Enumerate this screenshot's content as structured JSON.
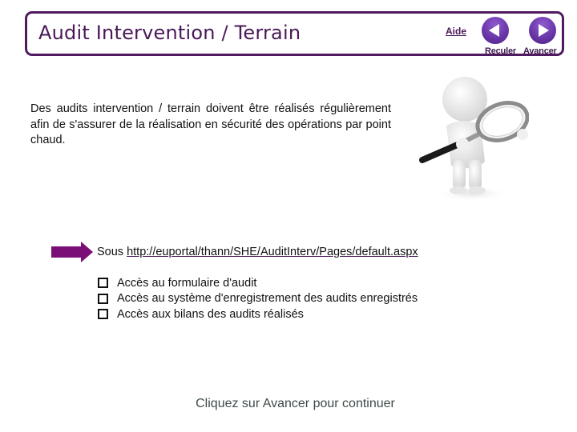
{
  "header": {
    "title": "Audit Intervention / Terrain",
    "help_link": "Aide",
    "nav": {
      "back_label": "Reculer",
      "forward_label": "Avancer"
    }
  },
  "intro": {
    "text": "Des audits intervention / terrain doivent être réalisés régulièrement afin de s'assurer de la réalisation en sécurité des opérations par point chaud."
  },
  "location": {
    "prefix": "Sous",
    "url": "http://euportal/thann/SHE/AuditInterv/Pages/default.aspx"
  },
  "bullets": [
    {
      "text": "Accès au formulaire d'audit"
    },
    {
      "text": "Accès au système d'enregistrement des audits enregistrés"
    },
    {
      "text": "Accès aux bilans des audits réalisés"
    }
  ],
  "footer": {
    "text": "Cliquez sur Avancer pour continuer"
  },
  "colors": {
    "brand": "#4f1a60",
    "button": "#6a37a9",
    "arrow": "#7a0f78"
  }
}
